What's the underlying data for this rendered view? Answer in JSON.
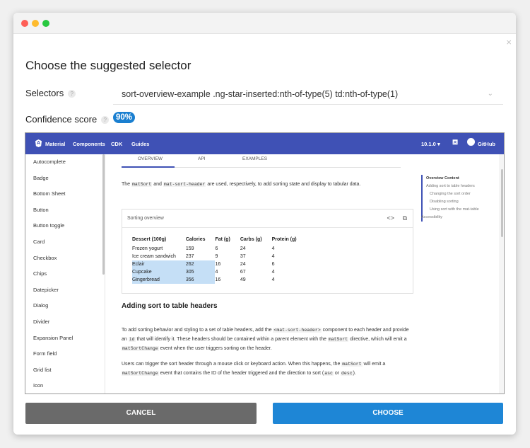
{
  "dialog": {
    "title": "Choose the suggested selector",
    "selectors_label": "Selectors",
    "selector_value": "sort-overview-example .ng-star-inserted:nth-of-type(5) td:nth-of-type(1)",
    "confidence_label": "Confidence score",
    "confidence_value": "90%",
    "cancel_label": "CANCEL",
    "choose_label": "CHOOSE",
    "help_glyph": "?",
    "close_glyph": "×",
    "caret_glyph": "⌄"
  },
  "colors": {
    "primary": "#3f51b5",
    "accent_blue": "#1e86d6",
    "cancel_gray": "#6a6a6a",
    "highlight": "#c5dff6"
  },
  "preview": {
    "toolbar": {
      "logo_letter": "A",
      "brand": "Material",
      "nav": [
        "Components",
        "CDK",
        "Guides"
      ],
      "version": "10.1.0",
      "github": "GitHub"
    },
    "sidenav": [
      "Autocomplete",
      "Badge",
      "Bottom Sheet",
      "Button",
      "Button toggle",
      "Card",
      "Checkbox",
      "Chips",
      "Datepicker",
      "Dialog",
      "Divider",
      "Expansion Panel",
      "Form field",
      "Grid list",
      "Icon"
    ],
    "tabs": [
      "OVERVIEW",
      "API",
      "EXAMPLES"
    ],
    "intro": {
      "p1": "The ",
      "c1": "matSort",
      "p2": " and ",
      "c2": "mat-sort-header",
      "p3": " are used, respectively, to add sorting state and display to tabular data."
    },
    "example": {
      "title": "Sorting overview",
      "code_icon": "<>",
      "open_icon": "⧉",
      "headers": [
        "Dessert (100g)",
        "Calories",
        "Fat (g)",
        "Carbs (g)",
        "Protein (g)"
      ],
      "rows": [
        [
          "Frozen yogurt",
          "159",
          "6",
          "24",
          "4"
        ],
        [
          "Ice cream sandwich",
          "237",
          "9",
          "37",
          "4"
        ],
        [
          "Eclair",
          "262",
          "16",
          "24",
          "6"
        ],
        [
          "Cupcake",
          "305",
          "4",
          "67",
          "4"
        ],
        [
          "Gingerbread",
          "356",
          "16",
          "49",
          "4"
        ]
      ]
    },
    "section_title": "Adding sort to table headers",
    "para1": {
      "a": "To add sorting behavior and styling to a set of table headers, add the ",
      "c1": "<mat-sort-header>",
      "b": " component to each header and provide an ",
      "c2": "id",
      "c": " that will identify it. These headers should be contained within a parent element with the ",
      "c3": "matSort",
      "d": " directive, which will emit a ",
      "c4": "matSortChange",
      "e": " event when the user triggers sorting on the header."
    },
    "para2": {
      "a": "Users can trigger the sort header through a mouse click or keyboard action. When this happens, the ",
      "c1": "matSort",
      "b": " will emit a ",
      "c2": "matSortChange",
      "c": " event that contains the ID of the header triggered and the direction to sort (",
      "c3": "asc",
      "d": " or ",
      "c4": "desc",
      "e": ")."
    },
    "toc": {
      "heading": "Overview Content",
      "items": [
        "Adding sort to table headers",
        "Changing the sort order",
        "Disabling sorting",
        "Using sort with the mat-table"
      ],
      "after": "Accessibility"
    }
  }
}
